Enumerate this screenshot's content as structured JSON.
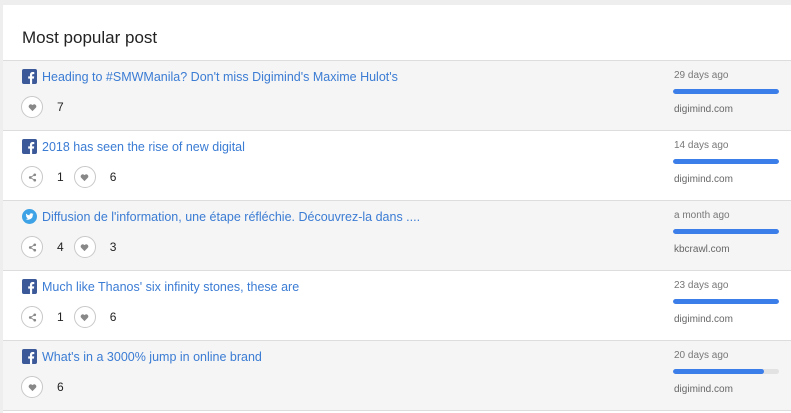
{
  "colors": {
    "accent": "#3b7de9",
    "link": "#3b7cd4",
    "facebook": "#3b5998",
    "twitter": "#3ea3e6"
  },
  "header": {
    "title": "Most popular post"
  },
  "posts": [
    {
      "network": "facebook-icon",
      "title": "Heading to #SMWManila? Don't miss Digimind's Maxime Hulot's",
      "shares": null,
      "likes": "7",
      "time": "29 days ago",
      "popularity": 1.0,
      "source": "digimind.com"
    },
    {
      "network": "facebook-icon",
      "title": "2018 has seen the rise of new digital",
      "shares": "1",
      "likes": "6",
      "time": "14 days ago",
      "popularity": 1.0,
      "source": "digimind.com"
    },
    {
      "network": "twitter-icon",
      "title": "Diffusion de l'information, une étape réfléchie. Découvrez-la dans ....",
      "shares": "4",
      "likes": "3",
      "time": "a month ago",
      "popularity": 1.0,
      "source": "kbcrawl.com"
    },
    {
      "network": "facebook-icon",
      "title": "Much like Thanos' six infinity stones, these are",
      "shares": "1",
      "likes": "6",
      "time": "23 days ago",
      "popularity": 1.0,
      "source": "digimind.com"
    },
    {
      "network": "facebook-icon",
      "title": "What's in a 3000% jump in online brand",
      "shares": null,
      "likes": "6",
      "time": "20 days ago",
      "popularity": 0.86,
      "source": "digimind.com"
    }
  ]
}
